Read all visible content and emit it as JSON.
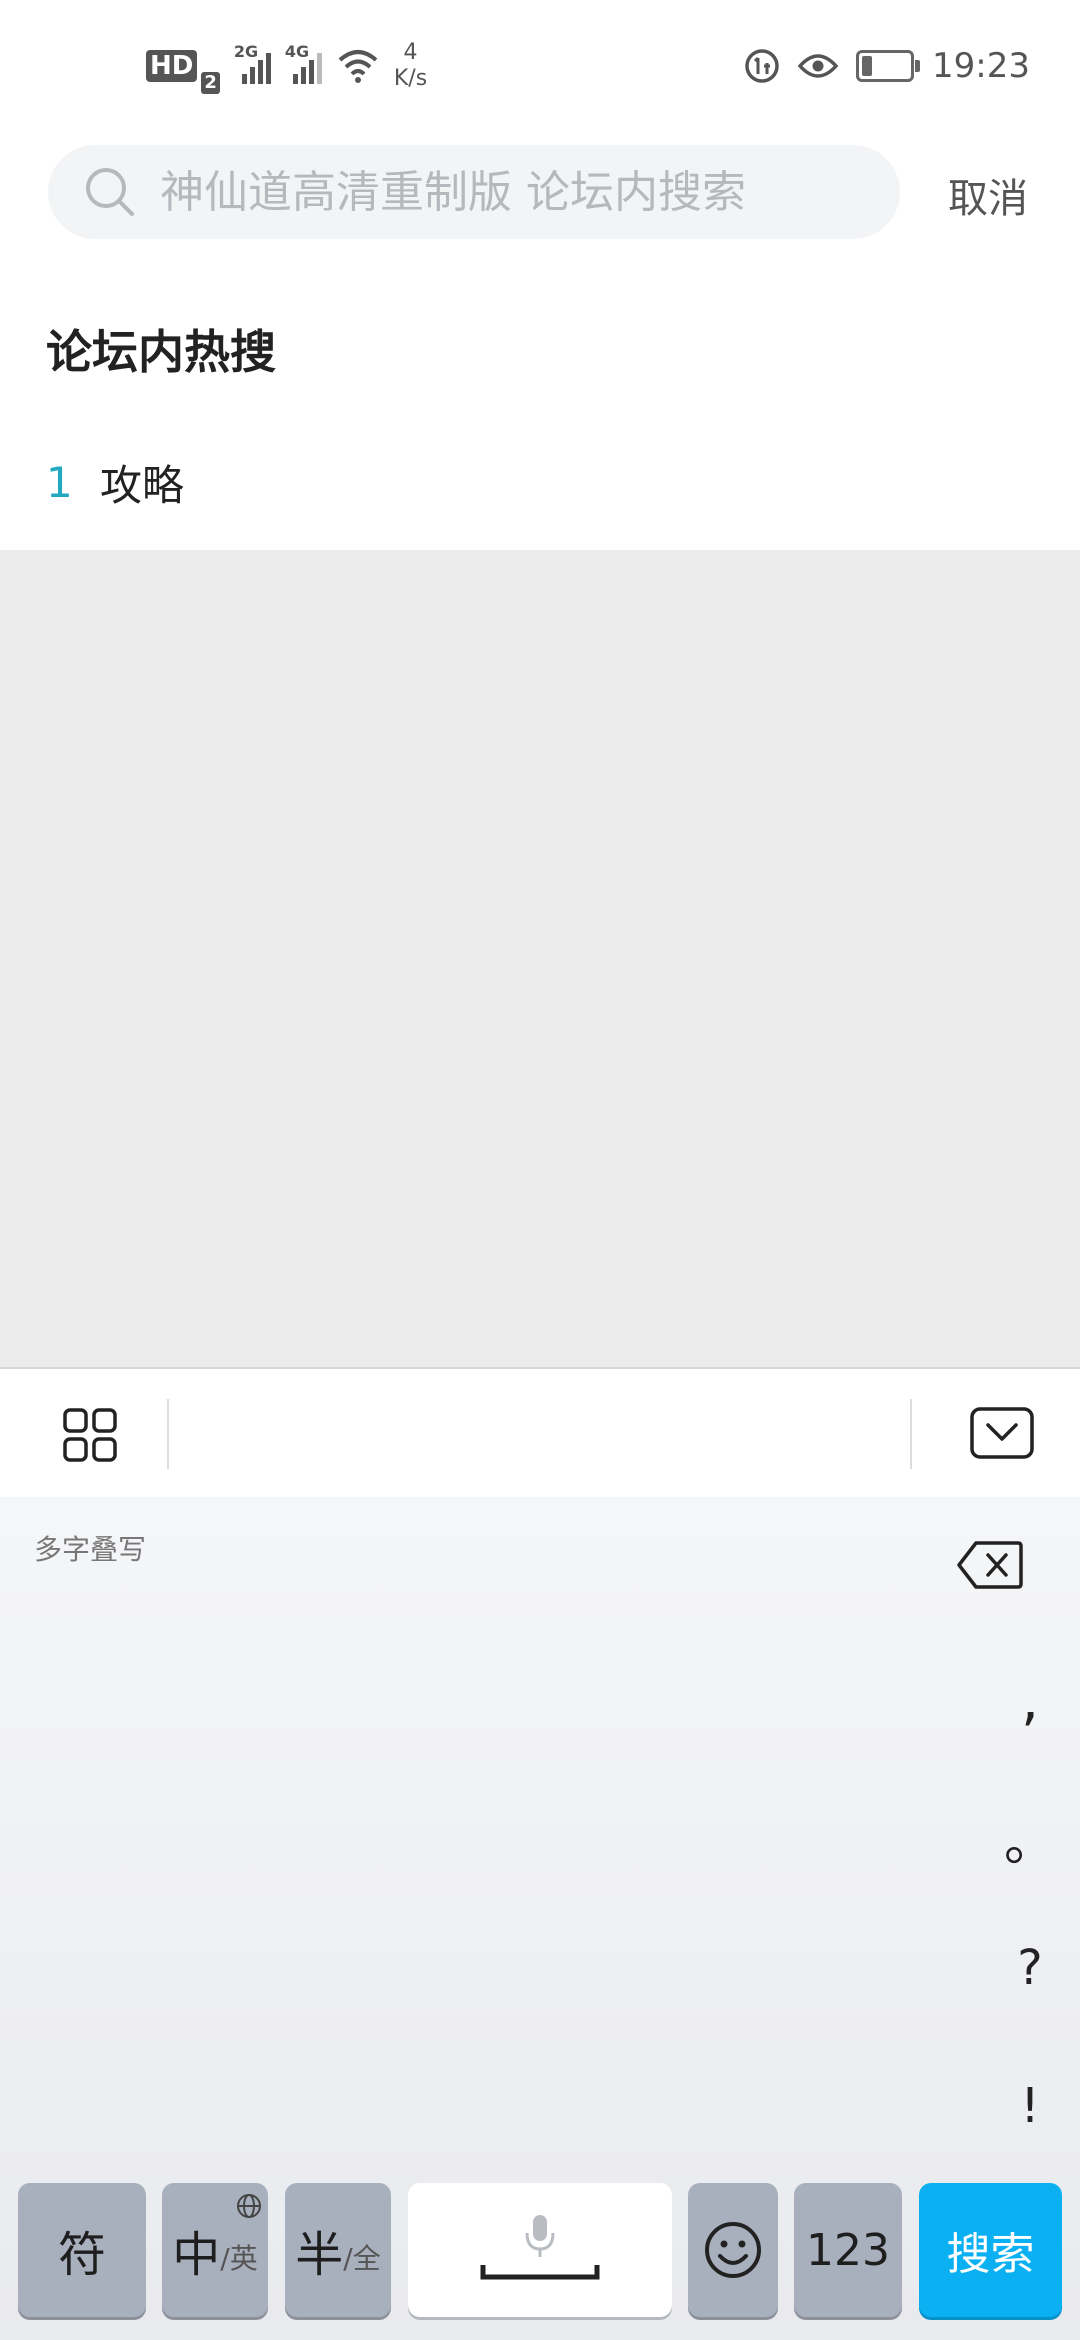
{
  "status_bar": {
    "hd_label": "HD",
    "sim_slot": "2",
    "network_1": "2G",
    "network_2": "4G",
    "speed_value": "4",
    "speed_unit": "K/s",
    "time": "19:23",
    "battery_level_percent": 25
  },
  "search": {
    "placeholder": "神仙道高清重制版 论坛内搜索",
    "value": "",
    "cancel_label": "取消"
  },
  "hot_search": {
    "title": "论坛内热搜",
    "items": [
      {
        "rank": "1",
        "text": "攻略"
      }
    ]
  },
  "keyboard": {
    "handwriting_label": "多字叠写",
    "punctuation": [
      ",",
      "。",
      "?",
      "!"
    ],
    "keys": {
      "symbol": "符",
      "lang_main": "中",
      "lang_sub": "/英",
      "width_main": "半",
      "width_sub": "/全",
      "numbers": "123",
      "search": "搜索"
    },
    "colors": {
      "search_key": "#0ab0f2",
      "function_key": "#a9b0bd"
    }
  }
}
